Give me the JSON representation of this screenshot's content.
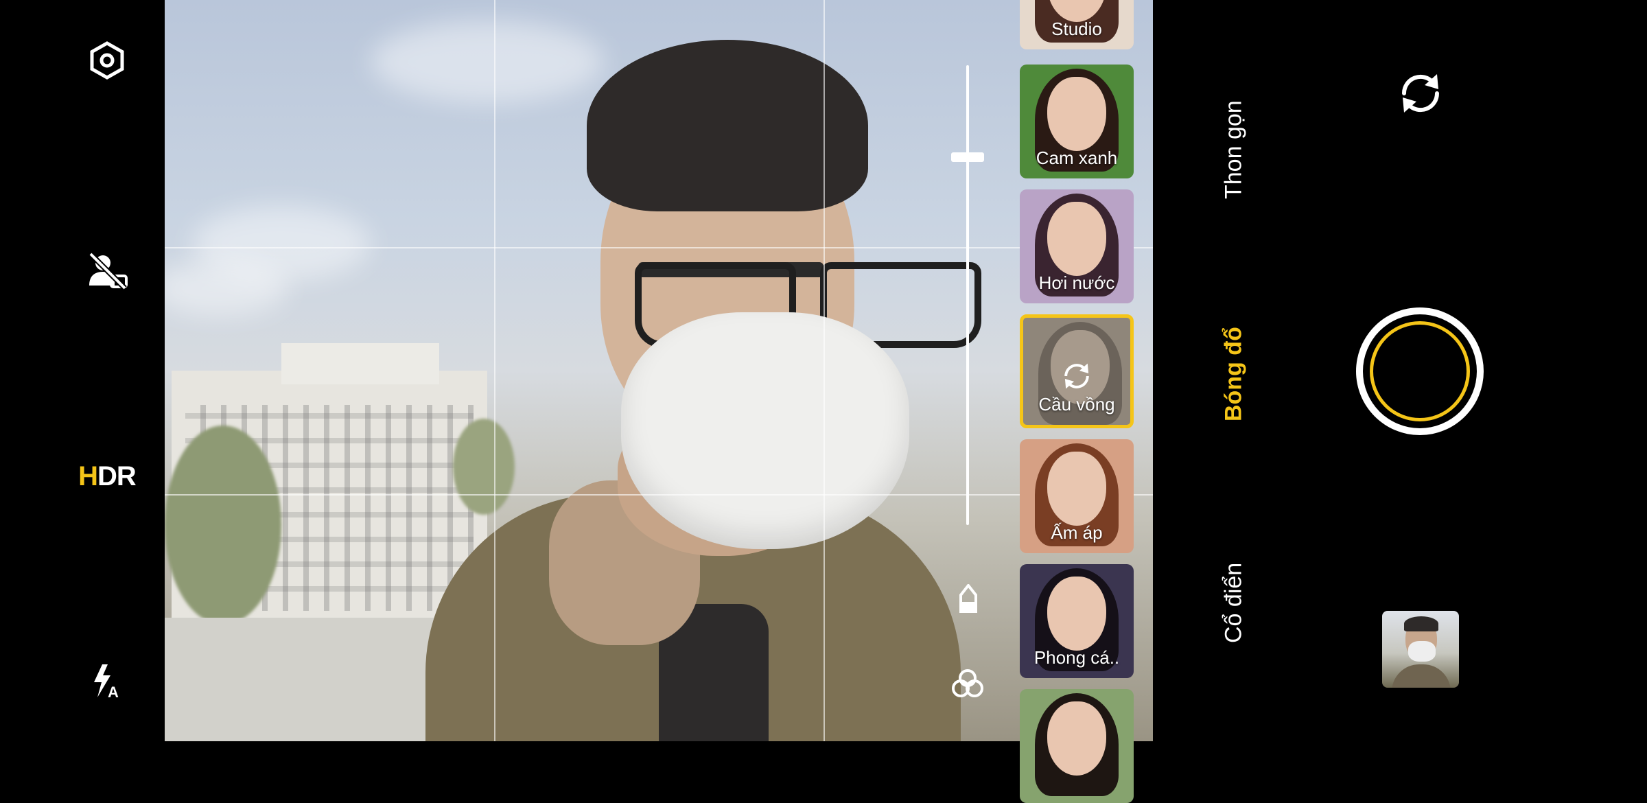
{
  "left_bar": {
    "settings_icon": "hexagon-settings-icon",
    "beauty_off_icon": "portrait-off-icon",
    "hdr": {
      "h": "H",
      "rest": "DR",
      "accent": "#f5c518"
    },
    "flash_icon": "flash-auto-icon"
  },
  "viewfinder": {
    "exposure_level": 0.2,
    "icons": [
      "exposure-icon",
      "filter-effects-icon"
    ]
  },
  "filters": [
    {
      "label": "Studio",
      "colors": [
        "#e6d9cc",
        "#4a2b22"
      ]
    },
    {
      "label": "Cam xanh",
      "colors": [
        "#4f8a3a",
        "#2a1a14"
      ]
    },
    {
      "label": "Hơi nước",
      "colors": [
        "#b9a3c6",
        "#3a2430"
      ]
    },
    {
      "label": "Cầu vồng",
      "colors": [
        "#8f867a",
        "#6b635a"
      ]
    },
    {
      "label": "Ấm áp",
      "colors": [
        "#d6a084",
        "#7a3e24"
      ]
    },
    {
      "label": "Phong cá..",
      "colors": [
        "#3b3550",
        "#151018"
      ]
    },
    {
      "label": "",
      "colors": [
        "#86a36e",
        "#1e1612"
      ]
    }
  ],
  "selected_filter_index": 3,
  "modes": [
    {
      "label": "Thon gọn",
      "active": false
    },
    {
      "label": "Bóng đổ",
      "active": true
    },
    {
      "label": "Cổ điển",
      "active": false
    }
  ],
  "accent_color": "#f5c518"
}
